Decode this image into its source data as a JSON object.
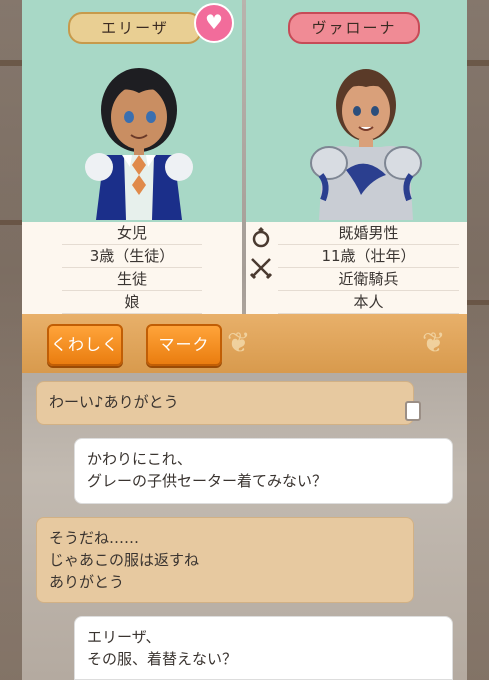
{
  "left_character": {
    "name": "エリーザ",
    "info": [
      "女児",
      "3歳（生徒）",
      "生徒",
      "娘"
    ]
  },
  "right_character": {
    "name": "ヴァローナ",
    "info": [
      "既婚男性",
      "11歳（壮年）",
      "近衛騎兵",
      "本人"
    ]
  },
  "icons": {
    "favorite": "heart-icon",
    "marriage": "ring-icon",
    "occupation": "crossed-swords-icon"
  },
  "toolbar": {
    "details_label": "くわしく",
    "mark_label": "マーク"
  },
  "messages": [
    {
      "side": "theirs",
      "text": "わーい♪ありがとう"
    },
    {
      "side": "mine",
      "text": "かわりにこれ、\nグレーの子供セーター着てみない？"
    },
    {
      "side": "theirs",
      "text": "そうだね……\nじゃあこの服は返すね\nありがとう"
    },
    {
      "side": "mine",
      "text": "エリーザ、\nその服、着替えない？"
    }
  ],
  "colors": {
    "portrait_bg": "#a8d8c6",
    "button_orange": "#f58d1f",
    "bubble_theirs": "#e7c9a0",
    "bubble_mine": "#ffffff"
  }
}
